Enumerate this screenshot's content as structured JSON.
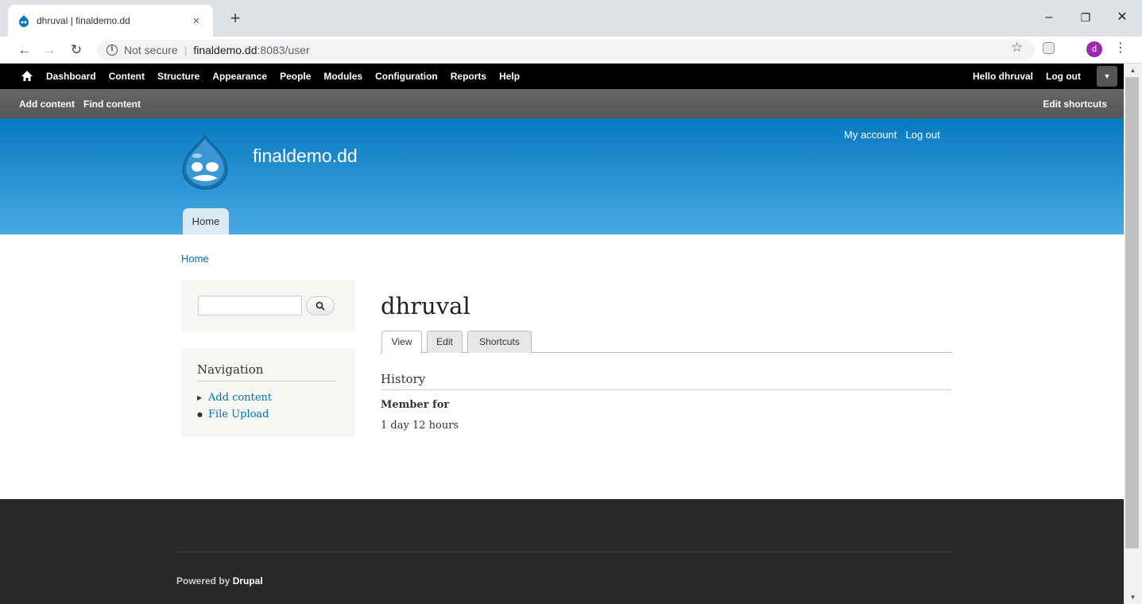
{
  "browser": {
    "tab_title": "dhruval | finaldemo.dd",
    "tab_close": "×",
    "new_tab": "+",
    "window_minimize": "–",
    "window_restore": "❐",
    "window_close": "✕",
    "url_security": "Not secure",
    "url_separator": "|",
    "url_host": "finaldemo.dd",
    "url_path": ":8083/user",
    "profile_initial": "d",
    "icons": [
      "back-arrow-icon",
      "forward-arrow-icon",
      "reload-icon",
      "info-icon",
      "star-icon",
      "extension-icon",
      "kebab-menu-icon"
    ]
  },
  "toolbar": {
    "items": [
      "Dashboard",
      "Content",
      "Structure",
      "Appearance",
      "People",
      "Modules",
      "Configuration",
      "Reports",
      "Help"
    ],
    "hello_prefix": "Hello ",
    "username": "dhruval",
    "logout": "Log out"
  },
  "shortcuts": {
    "items": [
      "Add content",
      "Find content"
    ],
    "edit": "Edit shortcuts"
  },
  "header": {
    "site_name": "finaldemo.dd",
    "secondary_menu": [
      "My account",
      "Log out"
    ],
    "main_tab": "Home",
    "color_top": "#0779bf",
    "color_bottom": "#48a9e4"
  },
  "breadcrumb": "Home",
  "sidebar": {
    "search_value": "",
    "nav_title": "Navigation",
    "nav_links": [
      "Add content",
      "File Upload"
    ]
  },
  "main": {
    "title": "dhruval",
    "tabs": [
      "View",
      "Edit",
      "Shortcuts"
    ],
    "active_tab": "View",
    "history_heading": "History",
    "member_label": "Member for",
    "member_value": "1 day 12 hours"
  },
  "footer": {
    "powered_prefix": "Powered by ",
    "powered_name": "Drupal"
  }
}
